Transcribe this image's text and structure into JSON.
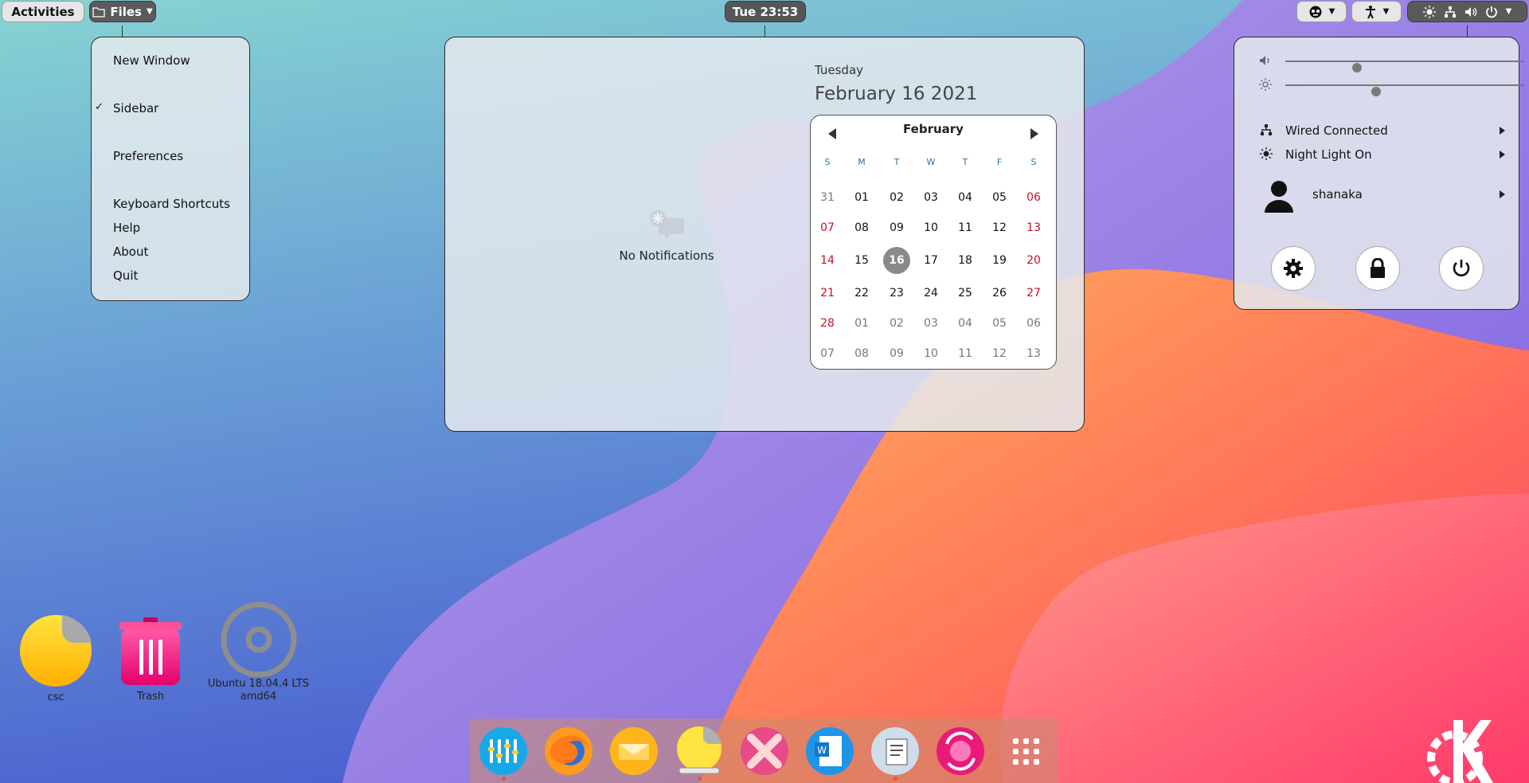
{
  "topbar": {
    "activities_label": "Activities",
    "files_label": "Files",
    "clock": "Tue 23:53"
  },
  "app_menu": {
    "items": [
      {
        "label": "New Window"
      },
      {
        "label": "Sidebar",
        "checked": true
      },
      {
        "label": "Preferences"
      },
      {
        "label": "Keyboard Shortcuts"
      },
      {
        "label": "Help"
      },
      {
        "label": "About"
      },
      {
        "label": "Quit"
      }
    ],
    "check_mark": "✓"
  },
  "datemenu": {
    "notifications_empty_label": "No Notifications",
    "weekday": "Tuesday",
    "full_date": "February 16 2021",
    "calendar": {
      "month": "February",
      "weekdays": [
        "S",
        "M",
        "T",
        "W",
        "T",
        "F",
        "S"
      ],
      "weeks": [
        [
          "31",
          "01",
          "02",
          "03",
          "04",
          "05",
          "06"
        ],
        [
          "07",
          "08",
          "09",
          "10",
          "11",
          "12",
          "13"
        ],
        [
          "14",
          "15",
          "16",
          "17",
          "18",
          "19",
          "20"
        ],
        [
          "21",
          "22",
          "23",
          "24",
          "25",
          "26",
          "27"
        ],
        [
          "28",
          "01",
          "02",
          "03",
          "04",
          "05",
          "06"
        ],
        [
          "07",
          "08",
          "09",
          "10",
          "11",
          "12",
          "13"
        ]
      ],
      "today": "16",
      "weekend_color": "#c4102a",
      "today_color": "#8a8a8a"
    }
  },
  "system_menu": {
    "volume_level": 0.3,
    "brightness_level": 0.38,
    "network_label": "Wired Connected",
    "night_light_label": "Night Light On",
    "user_name": "shanaka"
  },
  "desktop": {
    "icons": [
      {
        "label": "csc",
        "icon": "folder-icon"
      },
      {
        "label": "Trash",
        "icon": "trash-icon"
      },
      {
        "label": "Ubuntu 18.04.4 LTS\namd64",
        "icon": "disc-icon"
      }
    ]
  },
  "dock": {
    "apps": [
      {
        "name": "equalizer-app-icon"
      },
      {
        "name": "firefox-icon"
      },
      {
        "name": "mail-icon"
      },
      {
        "name": "files-icon"
      },
      {
        "name": "network-manager-icon"
      },
      {
        "name": "writer-icon"
      },
      {
        "name": "text-editor-icon"
      },
      {
        "name": "software-updater-icon"
      },
      {
        "name": "app-grid-icon"
      }
    ],
    "running_indicator_color": "#e25a2c"
  }
}
